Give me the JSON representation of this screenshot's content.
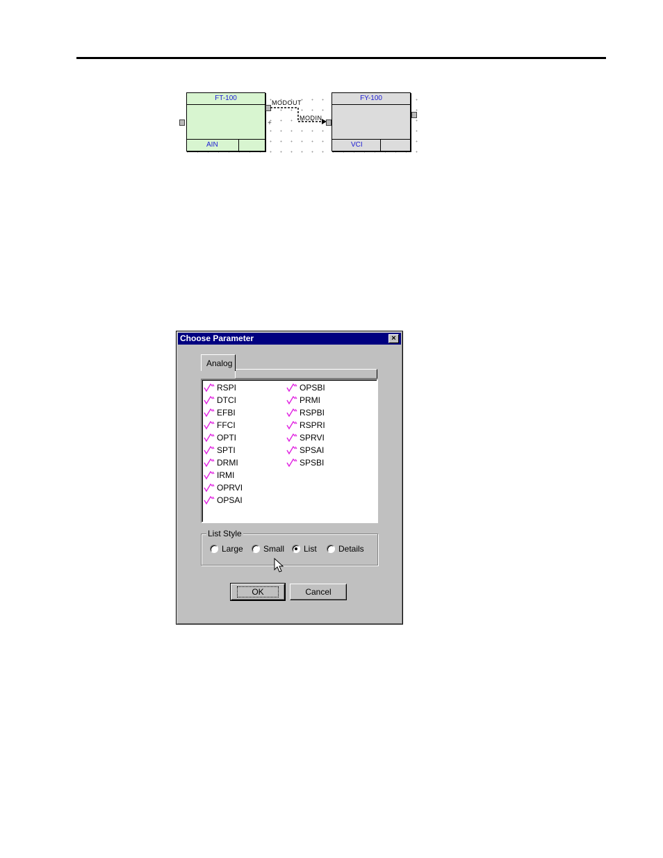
{
  "diagram": {
    "block_a": {
      "name": "FT-100",
      "type": "AIN"
    },
    "block_b": {
      "name": "FY-100",
      "type": "VCI"
    },
    "output_port_label": "MODOUT",
    "input_port_label": "MODIN",
    "colors": {
      "block_a_fill": "#d8f5d0",
      "block_b_fill": "#dcdcdc",
      "label_text": "#1b1bd4"
    }
  },
  "dialog": {
    "title": "Choose Parameter",
    "close_icon": "close-icon",
    "tab_label": "Analog",
    "parameter_icon": "analog-parameter-icon",
    "parameters_col1": [
      "RSPI",
      "DTCI",
      "EFBI",
      "FFCI",
      "OPTI",
      "SPTI",
      "DRMI",
      "IRMI",
      "OPRVI",
      "OPSAI"
    ],
    "parameters_col2": [
      "OPSBI",
      "PRMI",
      "RSPBI",
      "RSPRI",
      "SPRVI",
      "SPSAI",
      "SPSBI"
    ],
    "list_style": {
      "label": "List Style",
      "options": [
        "Large",
        "Small",
        "List",
        "Details"
      ],
      "selected": "List"
    },
    "ok_label": "OK",
    "cancel_label": "Cancel",
    "colors": {
      "titlebar": "#000080",
      "face": "#c0c0c0",
      "icon_accent": "#e020e0"
    }
  }
}
